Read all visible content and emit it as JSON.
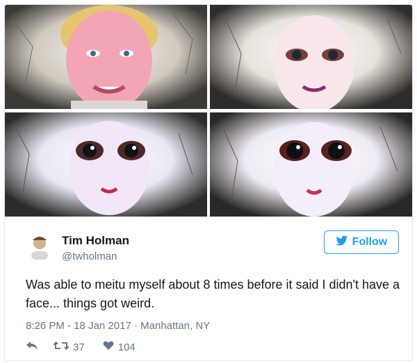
{
  "tweet": {
    "author_name": "Tim Holman",
    "author_handle": "@twholman",
    "follow_label": "Follow",
    "text": "Was able to meitu myself about 8 times before it said I didn't have a face... things got weird.",
    "time": "8:26 PM",
    "date": "18 Jan 2017",
    "location": "Manhattan, NY",
    "retweets": "37",
    "likes": "104"
  },
  "media": {
    "images": [
      {
        "name": "selfie-original",
        "eye_scale": 1.0
      },
      {
        "name": "selfie-filter-2",
        "eye_scale": 1.25
      },
      {
        "name": "selfie-filter-3",
        "eye_scale": 1.6
      },
      {
        "name": "selfie-filter-4",
        "eye_scale": 1.9
      }
    ]
  },
  "icons": {
    "follow": "twitter-bird-icon",
    "reply": "reply-icon",
    "retweet": "retweet-icon",
    "like": "heart-icon"
  },
  "colors": {
    "accent": "#1da1f2",
    "muted": "#657786",
    "text": "#14171a"
  }
}
